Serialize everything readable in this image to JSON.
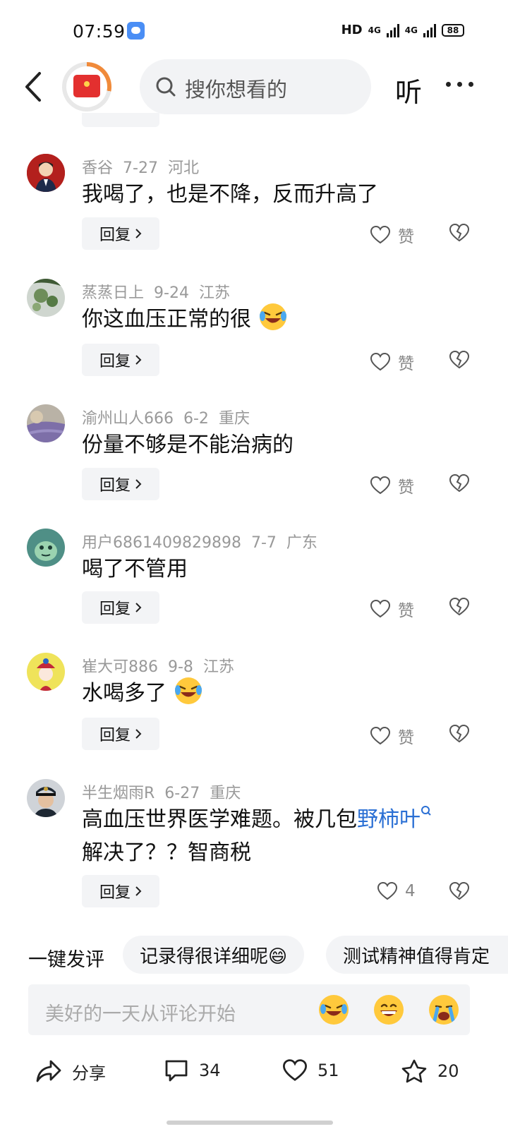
{
  "status_bar": {
    "time": "07:59",
    "hd": "HD",
    "net1": "4G",
    "net2": "4G",
    "battery": "88"
  },
  "nav": {
    "search_placeholder": "搜你想看的",
    "listen_label": "听"
  },
  "comments": [
    {
      "user": "香谷",
      "date": "7-27",
      "region": "河北",
      "text": "我喝了，也是不降，反而升高了",
      "reply_label": "回复",
      "like_label": "赞"
    },
    {
      "user": "蒸蒸日上",
      "date": "9-24",
      "region": "江苏",
      "text": "你这血压正常的很",
      "reply_label": "回复",
      "like_label": "赞"
    },
    {
      "user": "渝州山人666",
      "date": "6-2",
      "region": "重庆",
      "text": "份量不够是不能治病的",
      "reply_label": "回复",
      "like_label": "赞"
    },
    {
      "user": "用户6861409829898",
      "date": "7-7",
      "region": "广东",
      "text": "喝了不管用",
      "reply_label": "回复",
      "like_label": "赞"
    },
    {
      "user": "崔大可886",
      "date": "9-8",
      "region": "江苏",
      "text": "水喝多了",
      "reply_label": "回复",
      "like_label": "赞"
    },
    {
      "user": "半生烟雨R",
      "date": "6-27",
      "region": "重庆",
      "text_line1": "高血压世界医学难题。被几包",
      "link": "野柿叶",
      "text_line2": "解决了？？智商税",
      "reply_label": "回复",
      "like_count": "4"
    }
  ],
  "quick_reply": {
    "label": "一键发评",
    "chips": [
      "记录得很详细呢😄",
      "测试精神值得肯定"
    ]
  },
  "comment_input": {
    "placeholder": "美好的一天从评论开始"
  },
  "bottom_bar": {
    "share_label": "分享",
    "comment_count": "34",
    "like_count": "51",
    "favorite_count": "20"
  },
  "colors": {
    "link": "#2a6fd4",
    "logo_red": "#e3302f",
    "logo_ring": "#f08a3a"
  }
}
